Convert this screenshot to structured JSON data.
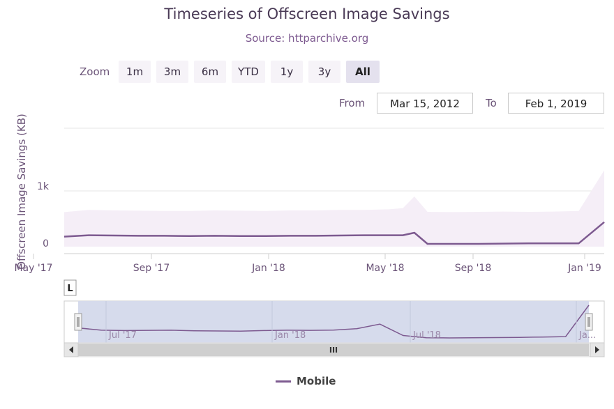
{
  "chart_data": {
    "type": "area",
    "title": "Timeseries of Offscreen Image Savings",
    "subtitle": "Source: httparchive.org",
    "ylabel": "Offscreen Image Savings (KB)",
    "ylim": [
      0,
      2000
    ],
    "yticks": [
      {
        "v": 0,
        "label": "0"
      },
      {
        "v": 1000,
        "label": "1k"
      }
    ],
    "x_ticks": [
      "May '17",
      "Sep '17",
      "Jan '18",
      "May '18",
      "Sep '18",
      "Jan '19"
    ],
    "series": [
      {
        "name": "Mobile",
        "color": "#7d5a90",
        "band_color": "#f5eef7",
        "x": [
          "Apr 15, 2017",
          "May 15, 2017",
          "Jun 15, 2017",
          "Jul 15, 2017",
          "Aug 15, 2017",
          "Sep 15, 2017",
          "Oct 15, 2017",
          "Nov 15, 2017",
          "Dec 15, 2017",
          "Jan 15, 2018",
          "Feb 15, 2018",
          "Mar 15, 2018",
          "Apr 15, 2018",
          "May 15, 2018",
          "Jun 1, 2018",
          "Jun 15, 2018",
          "Jul 1, 2018",
          "Aug 1, 2018",
          "Sep 1, 2018",
          "Oct 1, 2018",
          "Nov 1, 2018",
          "Dec 1, 2018",
          "Jan 1, 2019",
          "Feb 1, 2019"
        ],
        "values": [
          180,
          205,
          200,
          195,
          195,
          190,
          195,
          190,
          190,
          195,
          195,
          200,
          205,
          205,
          205,
          250,
          50,
          50,
          50,
          55,
          60,
          60,
          60,
          440
        ],
        "band_high": [
          620,
          660,
          650,
          645,
          640,
          640,
          650,
          645,
          640,
          650,
          650,
          660,
          660,
          670,
          690,
          900,
          625,
          620,
          625,
          630,
          625,
          630,
          640,
          1370
        ]
      }
    ],
    "navigator": {
      "ticks": [
        "Jul '17",
        "Jan '18",
        "Jul '18",
        "Ja..."
      ],
      "handle_glyph": "III",
      "values": [
        160,
        130,
        125,
        128,
        130,
        122,
        120,
        118,
        125,
        130,
        128,
        132,
        150,
        210,
        60,
        30,
        28,
        30,
        32,
        35,
        40,
        45,
        460
      ]
    },
    "legend_position": "bottom-center",
    "grid": true
  },
  "rangeSelector": {
    "zoom_label": "Zoom",
    "buttons": [
      "1m",
      "3m",
      "6m",
      "YTD",
      "1y",
      "3y",
      "All"
    ],
    "active": "All",
    "from_label": "From",
    "from_value": "Mar 15, 2012",
    "to_label": "To",
    "to_value": "Feb 1, 2019"
  },
  "plotBadge": "L",
  "legend": {
    "label": "Mobile"
  },
  "icons": {
    "scroll_left": "chevron-left-icon",
    "scroll_right": "chevron-right-icon",
    "handle": "grip-icon"
  }
}
